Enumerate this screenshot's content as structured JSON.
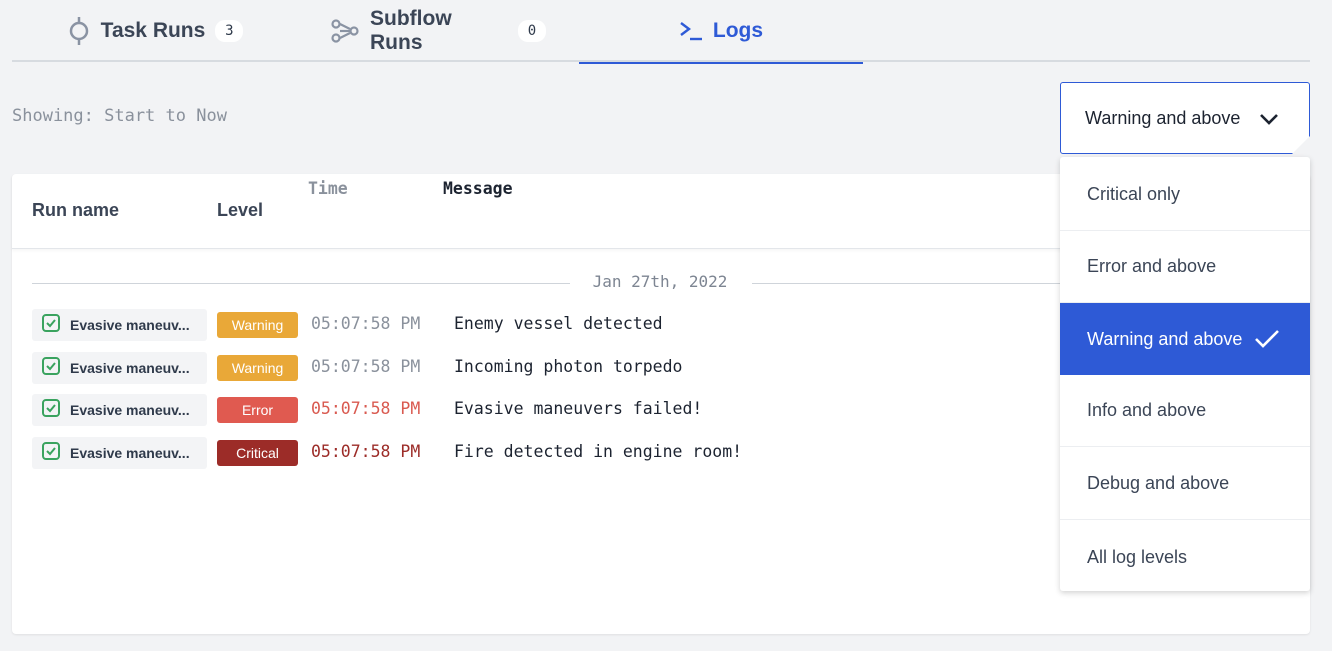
{
  "tabs": {
    "task_runs": {
      "label": "Task Runs",
      "count": "3",
      "icon": "task-run-icon"
    },
    "subflow_runs": {
      "label": "Subflow Runs",
      "count": "0",
      "icon": "subflow-icon"
    },
    "logs": {
      "label": "Logs",
      "icon": "terminal-icon",
      "active": true
    }
  },
  "showing": "Showing: Start to Now",
  "level_select": {
    "value": "Warning and above"
  },
  "table": {
    "headers": {
      "run_name": "Run name",
      "level": "Level",
      "time": "Time",
      "message": "Message"
    },
    "date": "Jan 27th, 2022",
    "rows": [
      {
        "run_name": "Evasive maneuv...",
        "level": "Warning",
        "time": "05:07:58 PM",
        "message": "Enemy vessel detected"
      },
      {
        "run_name": "Evasive maneuv...",
        "level": "Warning",
        "time": "05:07:58 PM",
        "message": "Incoming photon torpedo"
      },
      {
        "run_name": "Evasive maneuv...",
        "level": "Error",
        "time": "05:07:58 PM",
        "message": "Evasive maneuvers failed!"
      },
      {
        "run_name": "Evasive maneuv...",
        "level": "Critical",
        "time": "05:07:58 PM",
        "message": "Fire detected in engine room!"
      }
    ]
  },
  "dropdown": {
    "options": [
      {
        "label": "Critical only"
      },
      {
        "label": "Error and above"
      },
      {
        "label": "Warning and above",
        "selected": true
      },
      {
        "label": "Info and above"
      },
      {
        "label": "Debug and above"
      },
      {
        "label": "All log levels"
      }
    ]
  },
  "colors": {
    "accent": "#2e5ad6",
    "warning": "#e9a838",
    "error": "#e05a50",
    "critical": "#9c2c28",
    "success": "#3aa35f"
  }
}
